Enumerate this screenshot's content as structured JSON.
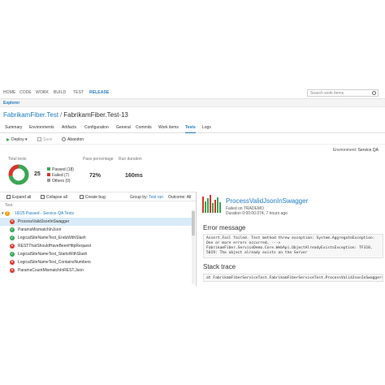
{
  "nav": {
    "items": [
      "HOME",
      "CODE",
      "WORK",
      "BUILD",
      "TEST",
      "RELEASE"
    ],
    "active_index": 5,
    "search_placeholder": "Search work items"
  },
  "subnav": {
    "explorer": "Explorer"
  },
  "breadcrumb": {
    "parent": "FabrikamFiber.Test",
    "separator": "/",
    "current": "FabrikamFiber.Test-13"
  },
  "tabs": [
    "Summary",
    "Environments",
    "Artifacts",
    "Configuration",
    "General",
    "Commits",
    "Work items",
    "Tests",
    "Logs"
  ],
  "active_tab": 7,
  "toolbar": {
    "deploy": "Deploy",
    "save": "Save",
    "abandon": "Abandon"
  },
  "environment": {
    "label": "Environment:",
    "value": "Service QA"
  },
  "summary": {
    "total_label": "Total tests",
    "total": "25",
    "legend": [
      "Passed (18)",
      "Failed (7)",
      "Others (0)"
    ],
    "pass_label": "Pass percentage",
    "pass_value": "72%",
    "duration_label": "Run duration",
    "duration_value": "160ms",
    "passed": 18,
    "failed": 7,
    "others": 0
  },
  "list_toolbar": {
    "expand": "Expand all",
    "collapse": "Collapse all",
    "create_bug": "Create bug",
    "group_by_label": "Group by:",
    "group_by_value": "Test run",
    "outcome": "Outcome: All"
  },
  "list_header": "Test",
  "tests": [
    {
      "name": "18/25 Passed - Service QA Tests",
      "status": "warn",
      "group": true
    },
    {
      "name": "ProcessValidJsonInSwagger",
      "status": "fail",
      "selected": true
    },
    {
      "name": "ParamsMismatchInJson",
      "status": "pass"
    },
    {
      "name": "LogicalSiteNameTest_EndsWithSlash",
      "status": "pass"
    },
    {
      "name": "RESTThatShouldHaveBeenHttpRequest",
      "status": "fail"
    },
    {
      "name": "LogicalSiteNameTest_StartsWithSlash",
      "status": "pass"
    },
    {
      "name": "LogicalSiteNameTest_ContainsNumbers",
      "status": "fail"
    },
    {
      "name": "ParamsCountMismatchInREST.Json",
      "status": "fail"
    }
  ],
  "detail": {
    "title": "ProcessValidJsonInSwagger",
    "failed_on": "Failed on TRADEMO",
    "duration": "Duration 0:00:00.074, 7 hours ago",
    "error_heading": "Error message",
    "error_text": "Assert.Fail failed. Test method threw exception: System.AggregateException:\nOne or more errors occurred. --->\nFabrikamFiber.ServiceDemo.Core.WebApi.ObjectAlreadyExistsException: TF310,\n5019: The object already exists on the Server",
    "trace_heading": "Stack trace",
    "trace_text": "at FabrikamFiberServiceTest.FabrikamFiberServiceTest.ProcessValidJsonInSwagger()",
    "history_bars": [
      "#d9342b",
      "#3aa655",
      "#3aa655",
      "#d9342b",
      "#3aa655",
      "#d9342b",
      "#3aa655",
      "#3aa655"
    ]
  },
  "colors": {
    "accent": "#1e7ac4",
    "pass": "#3aa655",
    "fail": "#d9342b",
    "warn": "#f0a30a"
  }
}
